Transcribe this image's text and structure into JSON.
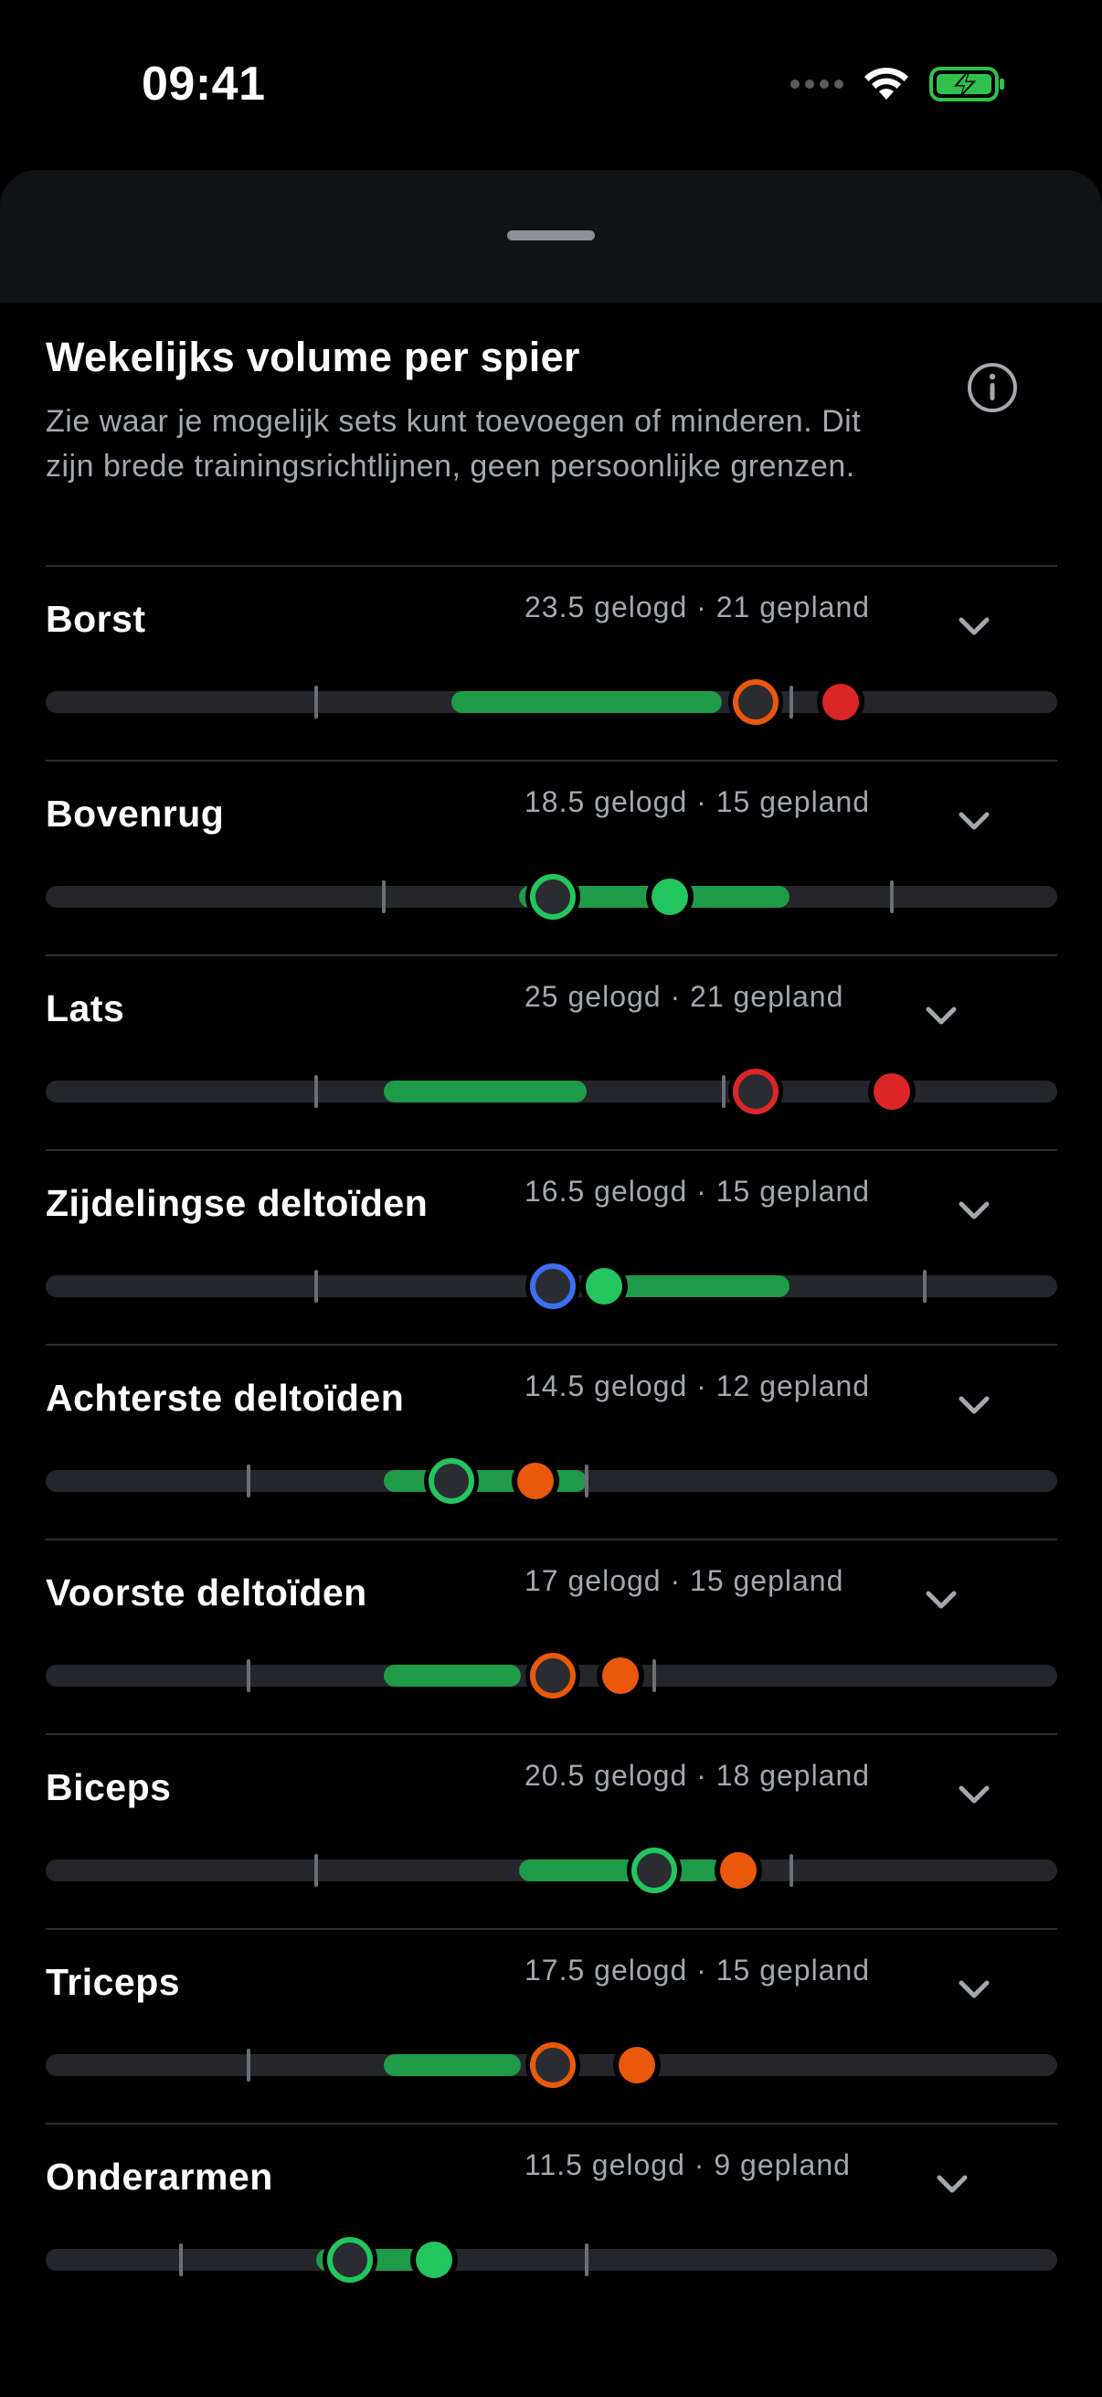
{
  "status_bar": {
    "time": "09:41"
  },
  "header": {
    "title": "Wekelijks volume per spier",
    "subtitle": "Zie waar je mogelijk sets kunt toevoegen of minderen. Dit zijn brede trainingsrichtlijnen, geen persoonlijke grenzen."
  },
  "colors": {
    "background": "#000000",
    "track": "#24262b",
    "range_green": "#1f9a48",
    "green": "#22c55e",
    "orange": "#ea580c",
    "red": "#dc2626",
    "blue": "#3b6ef0",
    "secondary_text": "#a3a7b0"
  },
  "muscles": [
    {
      "name": "Borst",
      "summary": "23.5 gelogd · 21 gepland"
    },
    {
      "name": "Bovenrug",
      "summary": "18.5 gelogd · 15 gepland"
    },
    {
      "name": "Lats",
      "summary": "25 gelogd · 21 gepland"
    },
    {
      "name": "Zijdelingse deltoïden",
      "summary": "16.5 gelogd · 15 gepland"
    },
    {
      "name": "Achterste deltoïden",
      "summary": "14.5 gelogd · 12 gepland"
    },
    {
      "name": "Voorste deltoïden",
      "summary": "17 gelogd · 15 gepland"
    },
    {
      "name": "Biceps",
      "summary": "20.5 gelogd · 18 gepland"
    },
    {
      "name": "Triceps",
      "summary": "17.5 gelogd · 15 gepland"
    },
    {
      "name": "Onderarmen",
      "summary": "11.5 gelogd · 9 gepland"
    }
  ]
}
